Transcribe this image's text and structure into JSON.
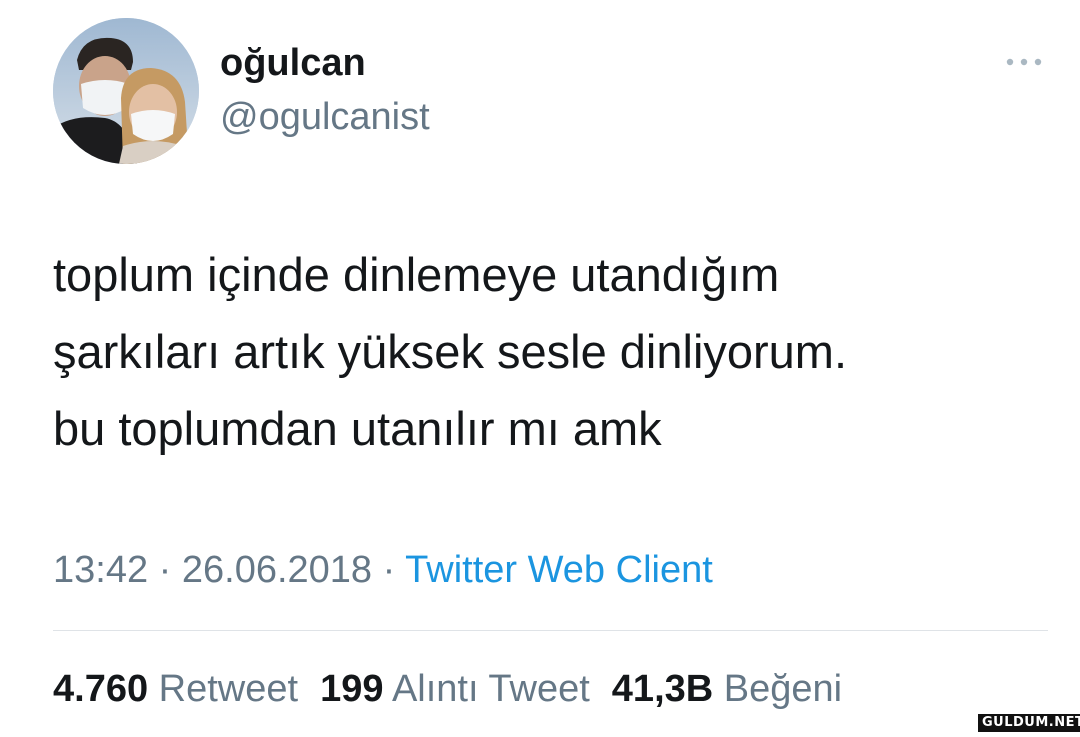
{
  "author": {
    "display_name": "oğulcan",
    "handle": "@ogulcanist"
  },
  "tweet": {
    "lines": [
      "toplum içinde dinlemeye utandığım",
      "şarkıları artık yüksek sesle dinliyorum.",
      "bu toplumdan utanılır mı amk"
    ]
  },
  "meta": {
    "time": "13:42",
    "separator": " · ",
    "date": "26.06.2018",
    "source": "Twitter Web Client"
  },
  "stats": {
    "retweets": {
      "count": "4.760",
      "label": "Retweet"
    },
    "quotes": {
      "count": "199",
      "label": "Alıntı Tweet"
    },
    "likes": {
      "count": "41,3B",
      "label": "Beğeni"
    }
  },
  "watermark": "GULDUM.NET",
  "colors": {
    "text_primary": "#14171a",
    "text_secondary": "#657786",
    "link": "#1b95e0",
    "divider": "#dfe3e7"
  },
  "icons": {
    "more": "more-horizontal-icon"
  }
}
